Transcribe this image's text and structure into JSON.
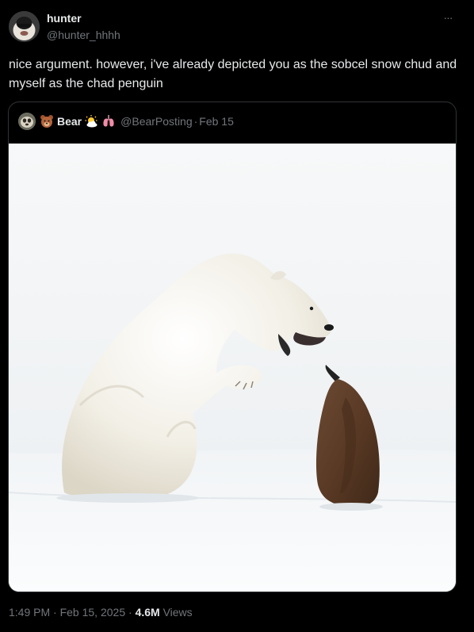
{
  "tweet": {
    "author_name": "hunter",
    "author_handle": "@hunter_hhhh",
    "more_label": "···",
    "text": "nice argument. however, i've already depicted you as the sobcel snow chud and myself as the chad penguin"
  },
  "quoted_tweet": {
    "author_name": "Bear",
    "author_handle": "@BearPosting",
    "separator": "·",
    "date": "Feb 15",
    "name_emojis": [
      "bear-face-emoji",
      "sun-behind-cloud-emoji",
      "lungs-emoji"
    ],
    "image_description_icons": [
      "polar-bear",
      "penguin"
    ]
  },
  "meta": {
    "time": "1:49 PM",
    "separator": "·",
    "date": "Feb 15, 2025",
    "separator2": "·",
    "views_count": "4.6M",
    "views_label": "Views"
  },
  "colors": {
    "background": "#000000",
    "primary_text": "#e7e9ea",
    "secondary_text": "#71767b",
    "border": "#2f3336"
  }
}
